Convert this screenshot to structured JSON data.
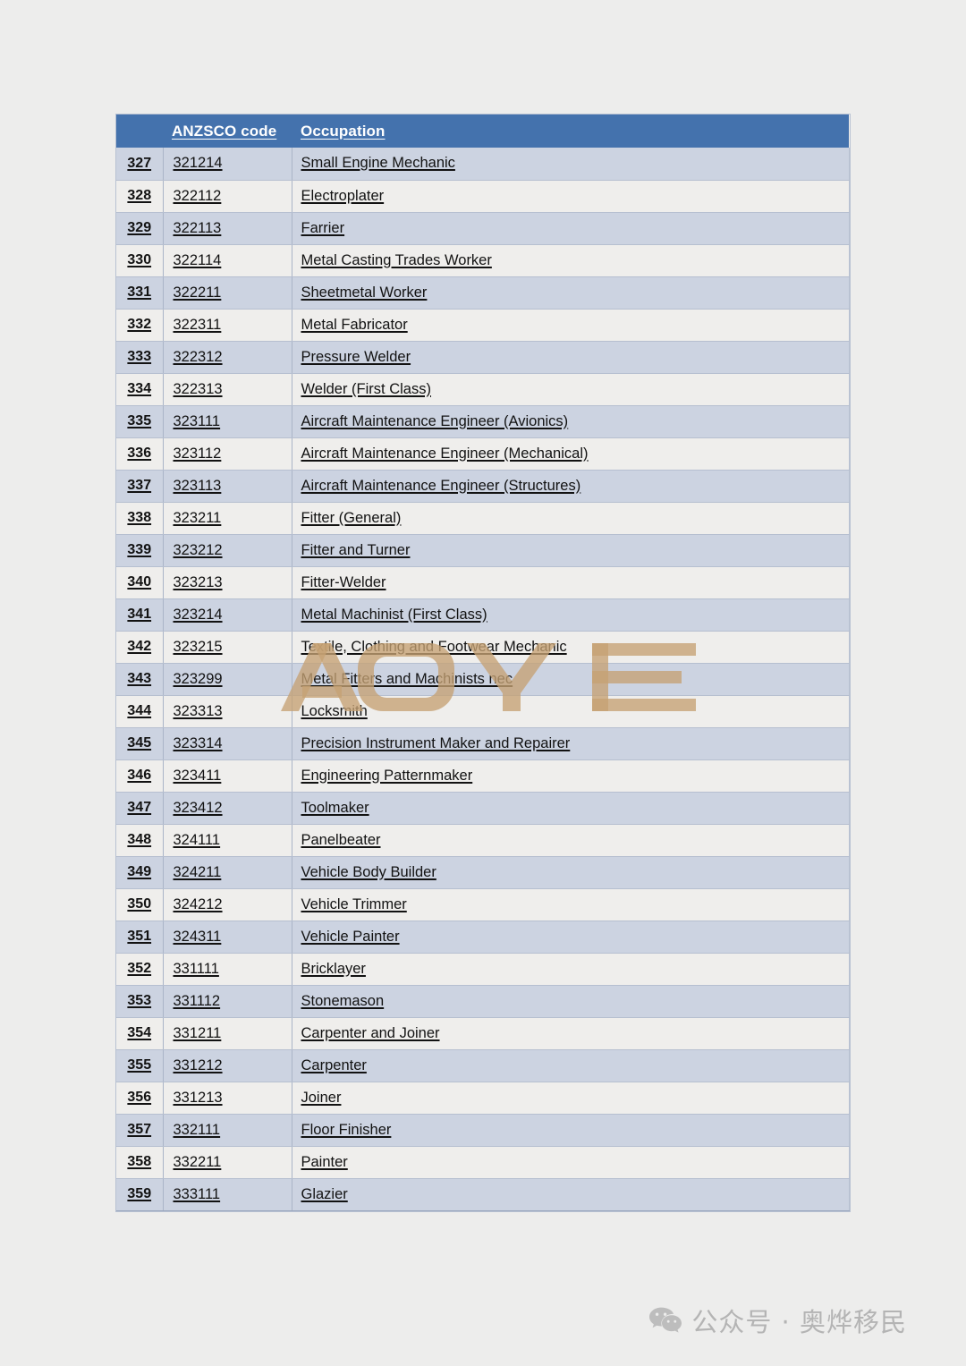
{
  "page": {
    "background_color": "#ededec",
    "watermark": {
      "text": "AOYE",
      "color": "#c5a273"
    }
  },
  "table": {
    "header_color": "#4472ad",
    "row_color_odd": "#ccd3e1",
    "row_color_even": "#efeeec",
    "columns": [
      {
        "key": "index",
        "label": ""
      },
      {
        "key": "code",
        "label": "ANZSCO code"
      },
      {
        "key": "occupation",
        "label": "Occupation"
      }
    ],
    "rows": [
      {
        "index": "327",
        "code": "321214",
        "occupation": "Small Engine Mechanic"
      },
      {
        "index": "328",
        "code": "322112",
        "occupation": "Electroplater"
      },
      {
        "index": "329",
        "code": "322113",
        "occupation": "Farrier"
      },
      {
        "index": "330",
        "code": "322114",
        "occupation": "Metal Casting Trades Worker"
      },
      {
        "index": "331",
        "code": "322211",
        "occupation": "Sheetmetal Worker"
      },
      {
        "index": "332",
        "code": "322311",
        "occupation": "Metal Fabricator"
      },
      {
        "index": "333",
        "code": "322312",
        "occupation": "Pressure Welder"
      },
      {
        "index": "334",
        "code": "322313",
        "occupation": "Welder (First Class)"
      },
      {
        "index": "335",
        "code": "323111",
        "occupation": "Aircraft Maintenance Engineer (Avionics)"
      },
      {
        "index": "336",
        "code": "323112",
        "occupation": "Aircraft Maintenance Engineer (Mechanical)"
      },
      {
        "index": "337",
        "code": "323113",
        "occupation": "Aircraft Maintenance Engineer (Structures)"
      },
      {
        "index": "338",
        "code": "323211",
        "occupation": "Fitter (General)"
      },
      {
        "index": "339",
        "code": "323212",
        "occupation": "Fitter and Turner"
      },
      {
        "index": "340",
        "code": "323213",
        "occupation": "Fitter-Welder"
      },
      {
        "index": "341",
        "code": "323214",
        "occupation": "Metal Machinist (First Class)"
      },
      {
        "index": "342",
        "code": "323215",
        "occupation": "Textile, Clothing and Footwear Mechanic"
      },
      {
        "index": "343",
        "code": "323299",
        "occupation": "Metal Fitters and Machinists nec"
      },
      {
        "index": "344",
        "code": "323313",
        "occupation": "Locksmith"
      },
      {
        "index": "345",
        "code": "323314",
        "occupation": "Precision Instrument Maker and Repairer"
      },
      {
        "index": "346",
        "code": "323411",
        "occupation": "Engineering Patternmaker"
      },
      {
        "index": "347",
        "code": "323412",
        "occupation": "Toolmaker"
      },
      {
        "index": "348",
        "code": "324111",
        "occupation": "Panelbeater"
      },
      {
        "index": "349",
        "code": "324211",
        "occupation": "Vehicle Body Builder"
      },
      {
        "index": "350",
        "code": "324212",
        "occupation": "Vehicle Trimmer"
      },
      {
        "index": "351",
        "code": "324311",
        "occupation": "Vehicle Painter"
      },
      {
        "index": "352",
        "code": "331111",
        "occupation": "Bricklayer"
      },
      {
        "index": "353",
        "code": "331112",
        "occupation": "Stonemason"
      },
      {
        "index": "354",
        "code": "331211",
        "occupation": "Carpenter and Joiner"
      },
      {
        "index": "355",
        "code": "331212",
        "occupation": "Carpenter"
      },
      {
        "index": "356",
        "code": "331213",
        "occupation": "Joiner"
      },
      {
        "index": "357",
        "code": "332111",
        "occupation": "Floor Finisher"
      },
      {
        "index": "358",
        "code": "332211",
        "occupation": "Painter"
      },
      {
        "index": "359",
        "code": "333111",
        "occupation": "Glazier"
      }
    ]
  },
  "footer": {
    "icon": "wechat-icon",
    "text": "公众号 · 奥烨移民",
    "color": "#b4b4b4"
  }
}
